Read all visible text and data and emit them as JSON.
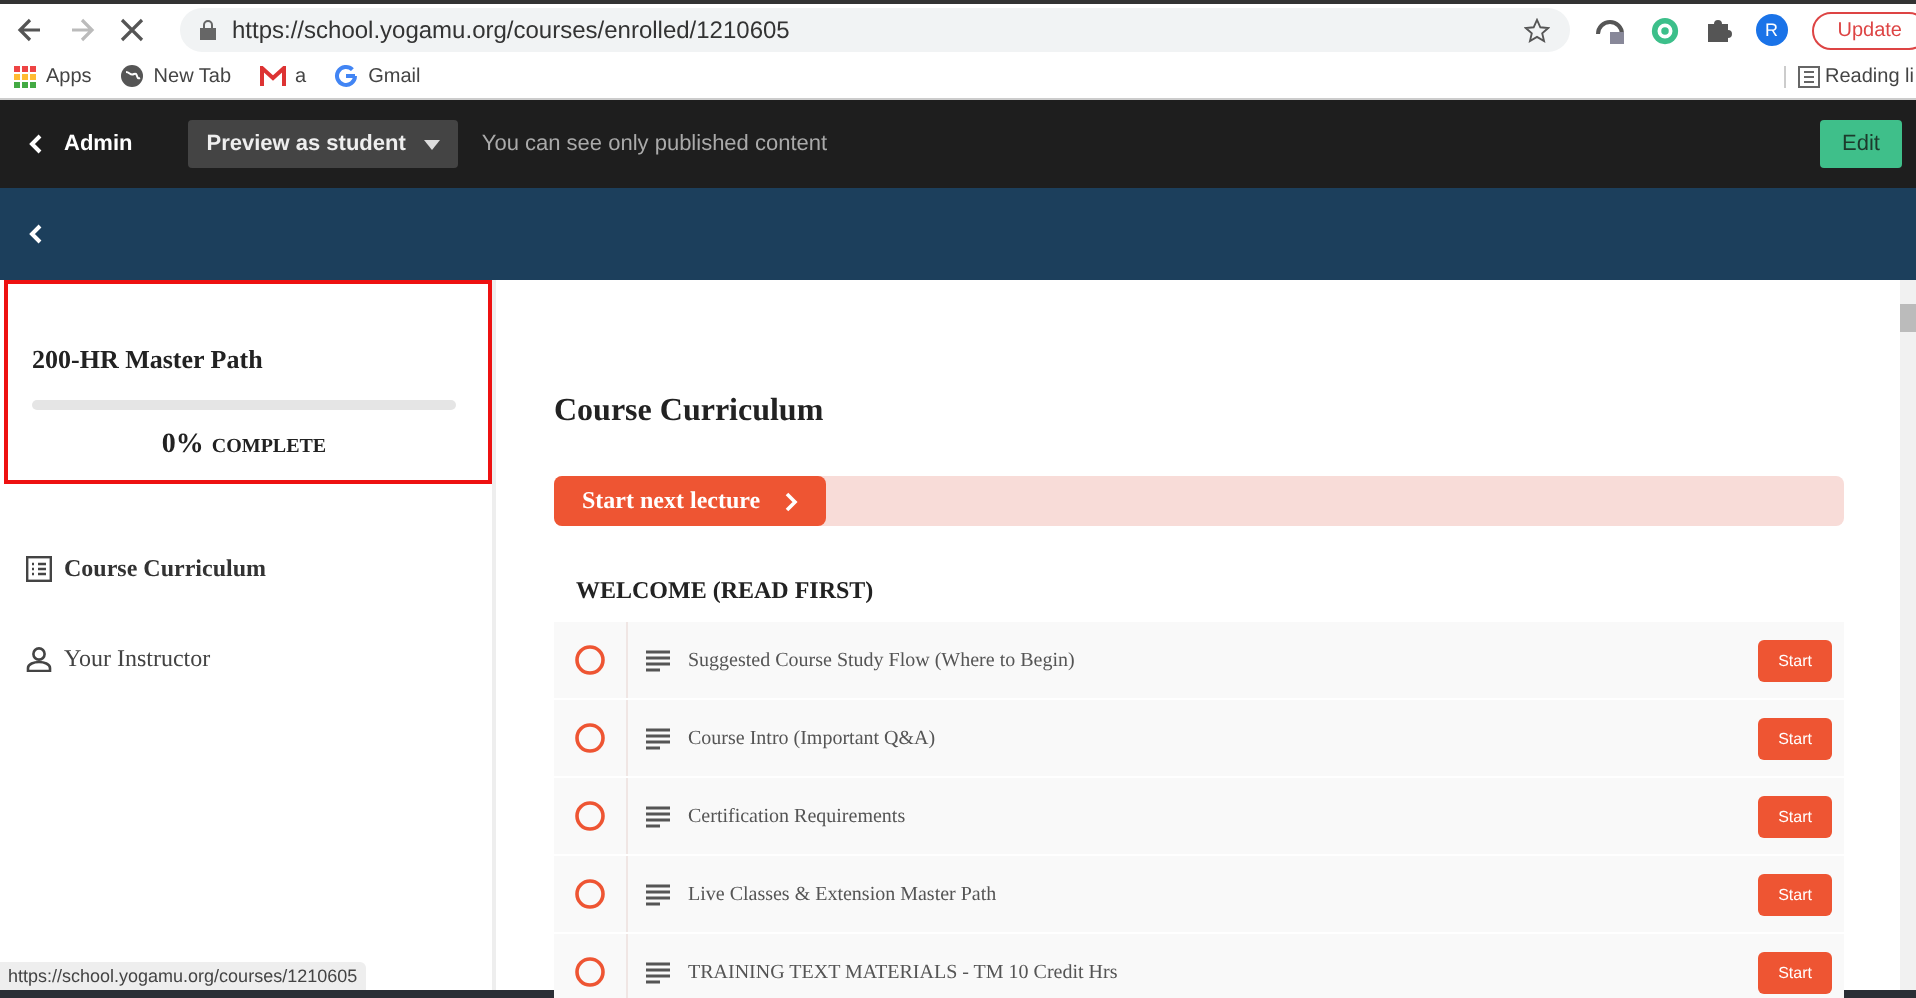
{
  "browser": {
    "url": "https://school.yogamu.org/courses/enrolled/1210605",
    "bookmarks": [
      "Apps",
      "New Tab",
      "a",
      "Gmail"
    ],
    "reading_list": "Reading li",
    "profile_initial": "R",
    "update_label": "Update",
    "status_url": "https://school.yogamu.org/courses/1210605"
  },
  "admin_bar": {
    "back_label": "Admin",
    "preview_label": "Preview as student",
    "note": "You can see only published content",
    "edit_label": "Edit"
  },
  "sidebar": {
    "course_title": "200-HR Master Path",
    "progress": {
      "level": 0,
      "percent": "0%",
      "label": "COMPLETE"
    },
    "items": [
      {
        "kind": "curriculum",
        "label": "Course Curriculum"
      },
      {
        "kind": "instructor",
        "label": "Your Instructor"
      }
    ]
  },
  "main": {
    "title": "Course Curriculum",
    "next_label": "Start next lecture",
    "sections": [
      {
        "title": "WELCOME (READ FIRST)",
        "lectures": [
          {
            "title": "Suggested Course Study Flow (Where to Begin)",
            "completed": false,
            "action": "Start"
          },
          {
            "title": "Course Intro (Important Q&A)",
            "completed": false,
            "action": "Start"
          },
          {
            "title": "Certification Requirements",
            "completed": false,
            "action": "Start"
          },
          {
            "title": "Live Classes & Extension Master Path",
            "completed": false,
            "action": "Start"
          },
          {
            "title": "TRAINING TEXT MATERIALS - TM 10 Credit Hrs",
            "completed": false,
            "action": "Start"
          }
        ]
      }
    ]
  }
}
